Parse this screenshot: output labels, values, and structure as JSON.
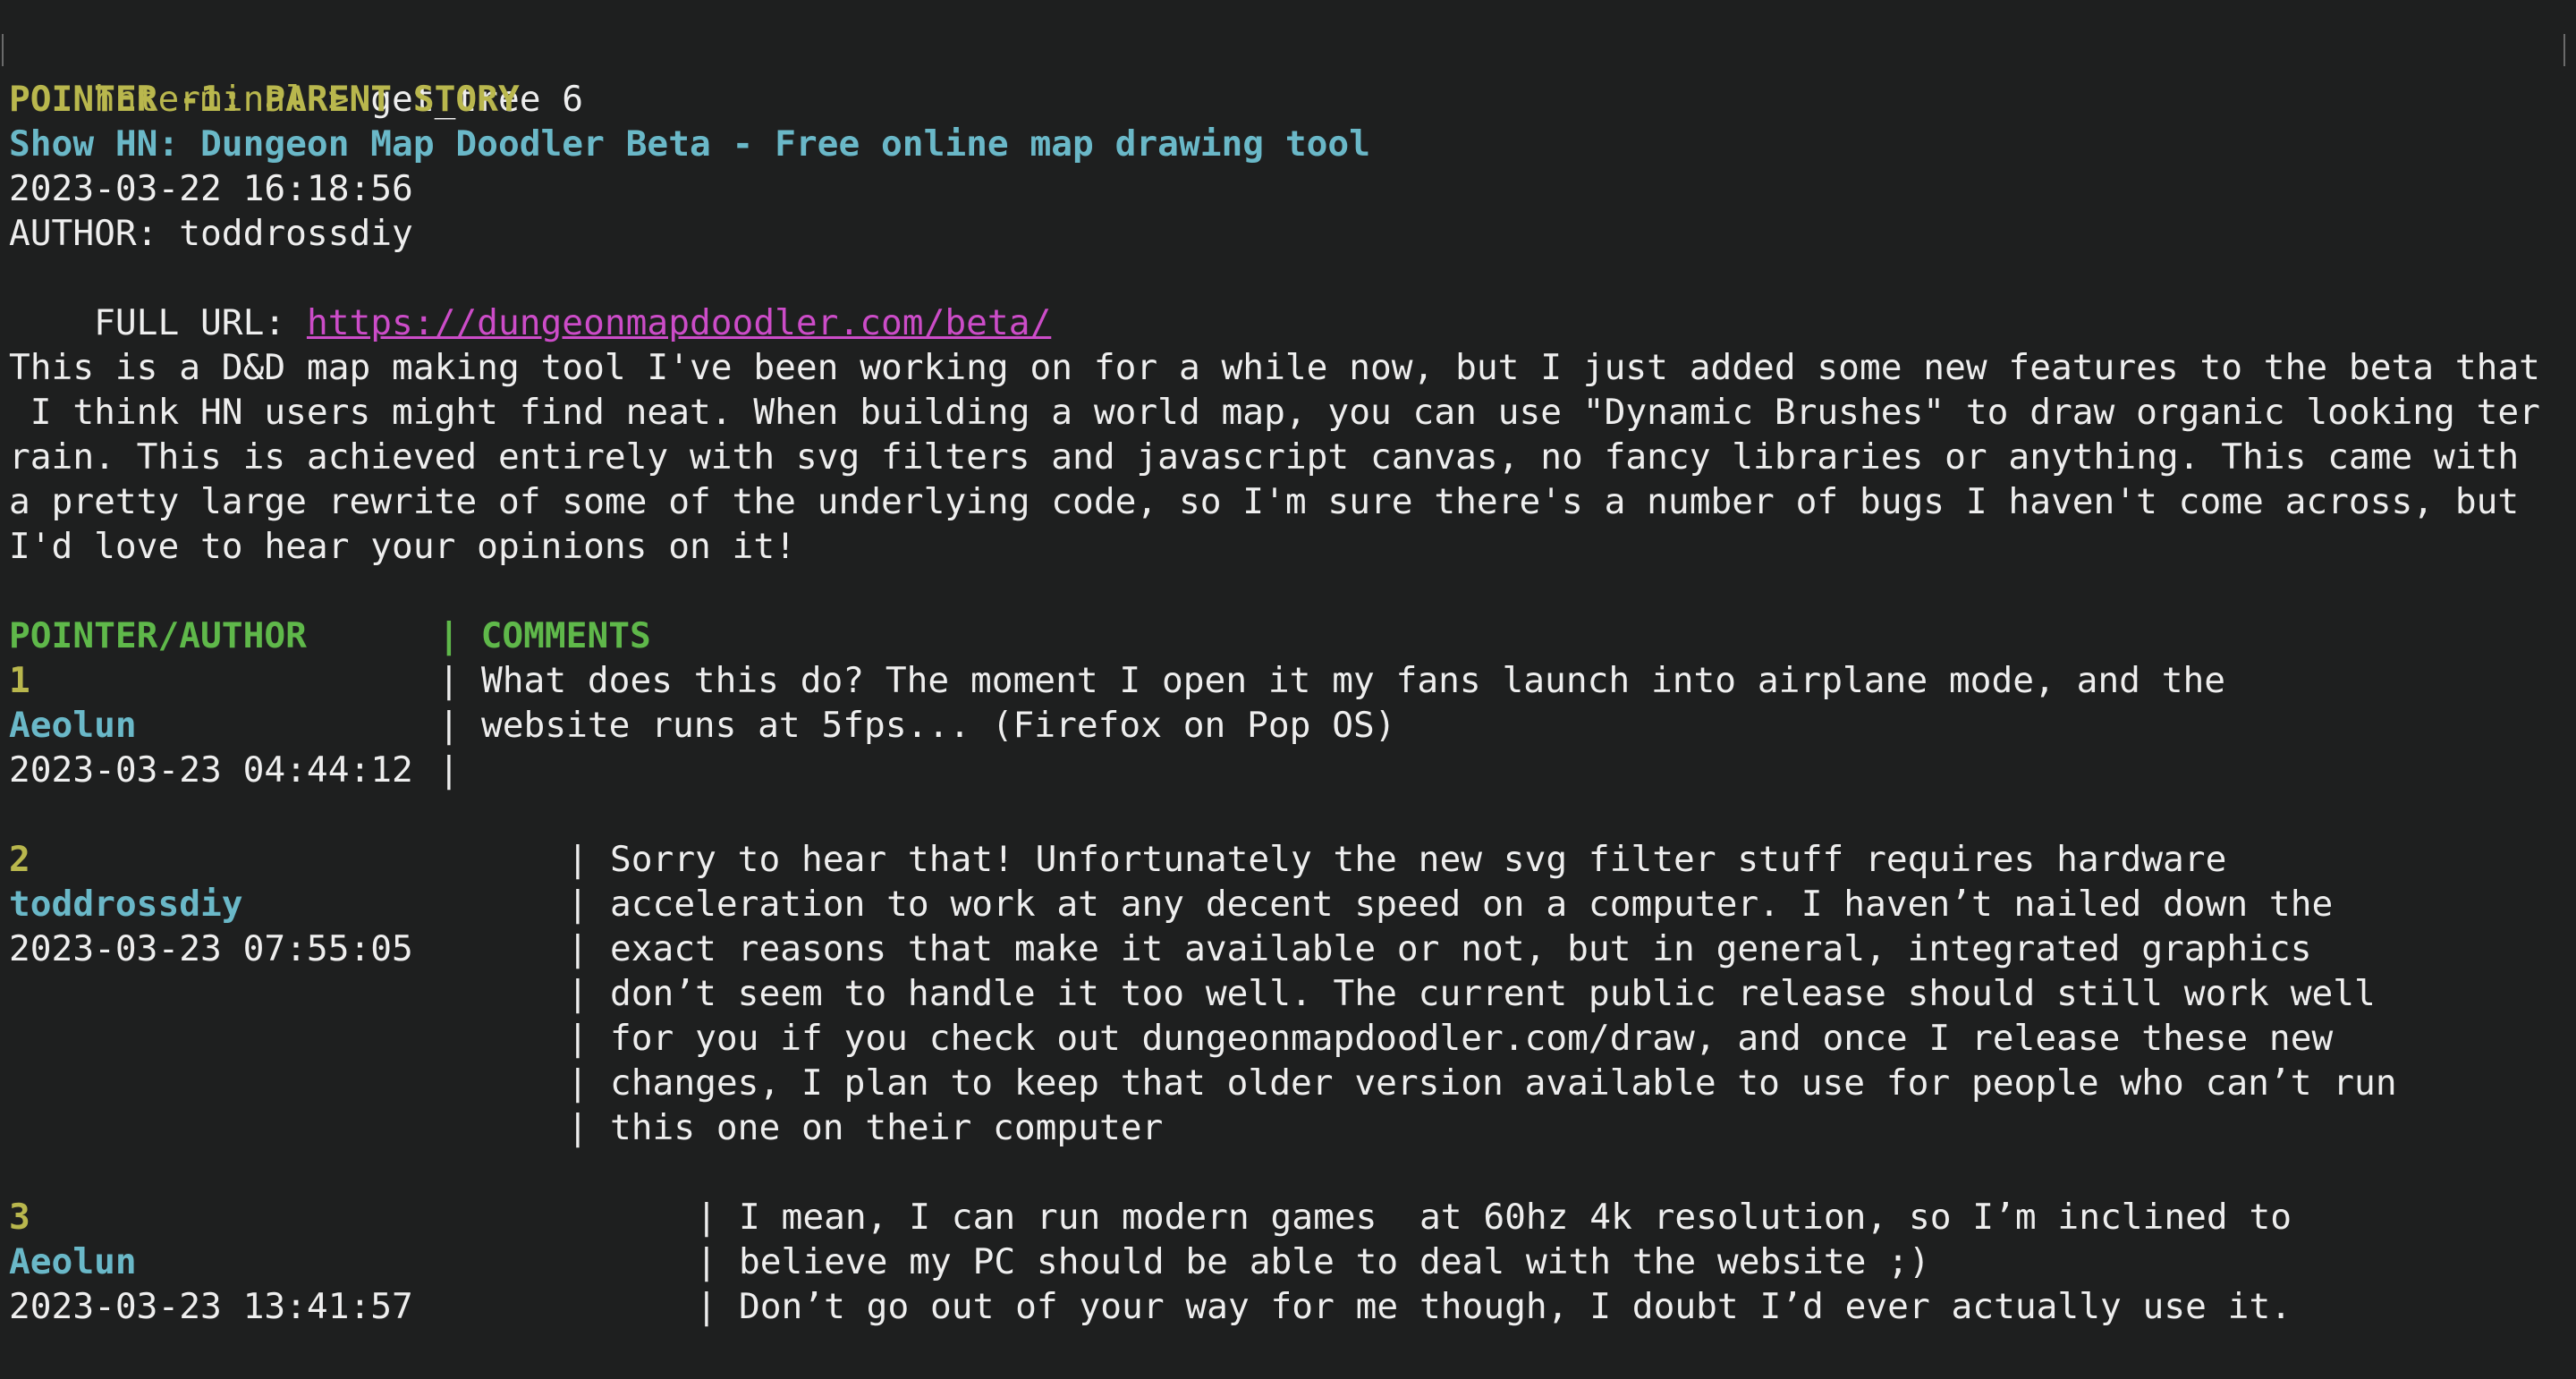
{
  "prompt": {
    "label": "hnterminal > ",
    "command": "get_tree 6"
  },
  "story": {
    "pointer_heading": "POINTER -1: PARENT STORY",
    "title": "Show HN: Dungeon Map Doodler Beta - Free online map drawing tool",
    "timestamp": "2023-03-22 16:18:56",
    "author_line": "AUTHOR: toddrossdiy",
    "url_label": "FULL URL: ",
    "url": "https://dungeonmapdoodler.com/beta/",
    "body_lines": [
      "This is a D&D map making tool I've been working on for a while now, but I just added some new features to the beta that",
      " I think HN users might find neat. When building a world map, you can use \"Dynamic Brushes\" to draw organic looking ter",
      "rain. This is achieved entirely with svg filters and javascript canvas, no fancy libraries or anything. This came with",
      "a pretty large rewrite of some of the underlying code, so I'm sure there's a number of bugs I haven't come across, but",
      "I'd love to hear your opinions on it!"
    ]
  },
  "table_header": {
    "left": "POINTER/AUTHOR",
    "sep": "| ",
    "right": "COMMENTS"
  },
  "comments": [
    {
      "pointer": "1",
      "author": "Aeolun",
      "timestamp": "2023-03-23 04:44:12",
      "lines": [
        "What does this do? The moment I open it my fans launch into airplane mode, and the",
        "website runs at 5fps... (Firefox on Pop OS)"
      ]
    },
    {
      "pointer": "2",
      "author": "toddrossdiy",
      "timestamp": "2023-03-23 07:55:05",
      "lines": [
        "Sorry to hear that! Unfortunately the new svg filter stuff requires hardware",
        "acceleration to work at any decent speed on a computer. I haven’t nailed down the",
        "exact reasons that make it available or not, but in general, integrated graphics",
        "don’t seem to handle it too well. The current public release should still work well",
        "for you if you check out dungeonmapdoodler.com/draw, and once I release these new",
        "changes, I plan to keep that older version available to use for people who can’t run",
        "this one on their computer"
      ]
    },
    {
      "pointer": "3",
      "author": "Aeolun",
      "timestamp": "2023-03-23 13:41:57",
      "lines": [
        "I mean, I can run modern games  at 60hz 4k resolution, so I’m inclined to",
        "believe my PC should be able to deal with the website ;)",
        "Don’t go out of your way for me though, I doubt I’d ever actually use it."
      ]
    }
  ],
  "colors": {
    "background": "#1e1f1f",
    "yellow": "#b9b74d",
    "cyan": "#6ab8c8",
    "green": "#5fb84a",
    "link": "#cc4cc8",
    "text": "#eeeeee"
  }
}
